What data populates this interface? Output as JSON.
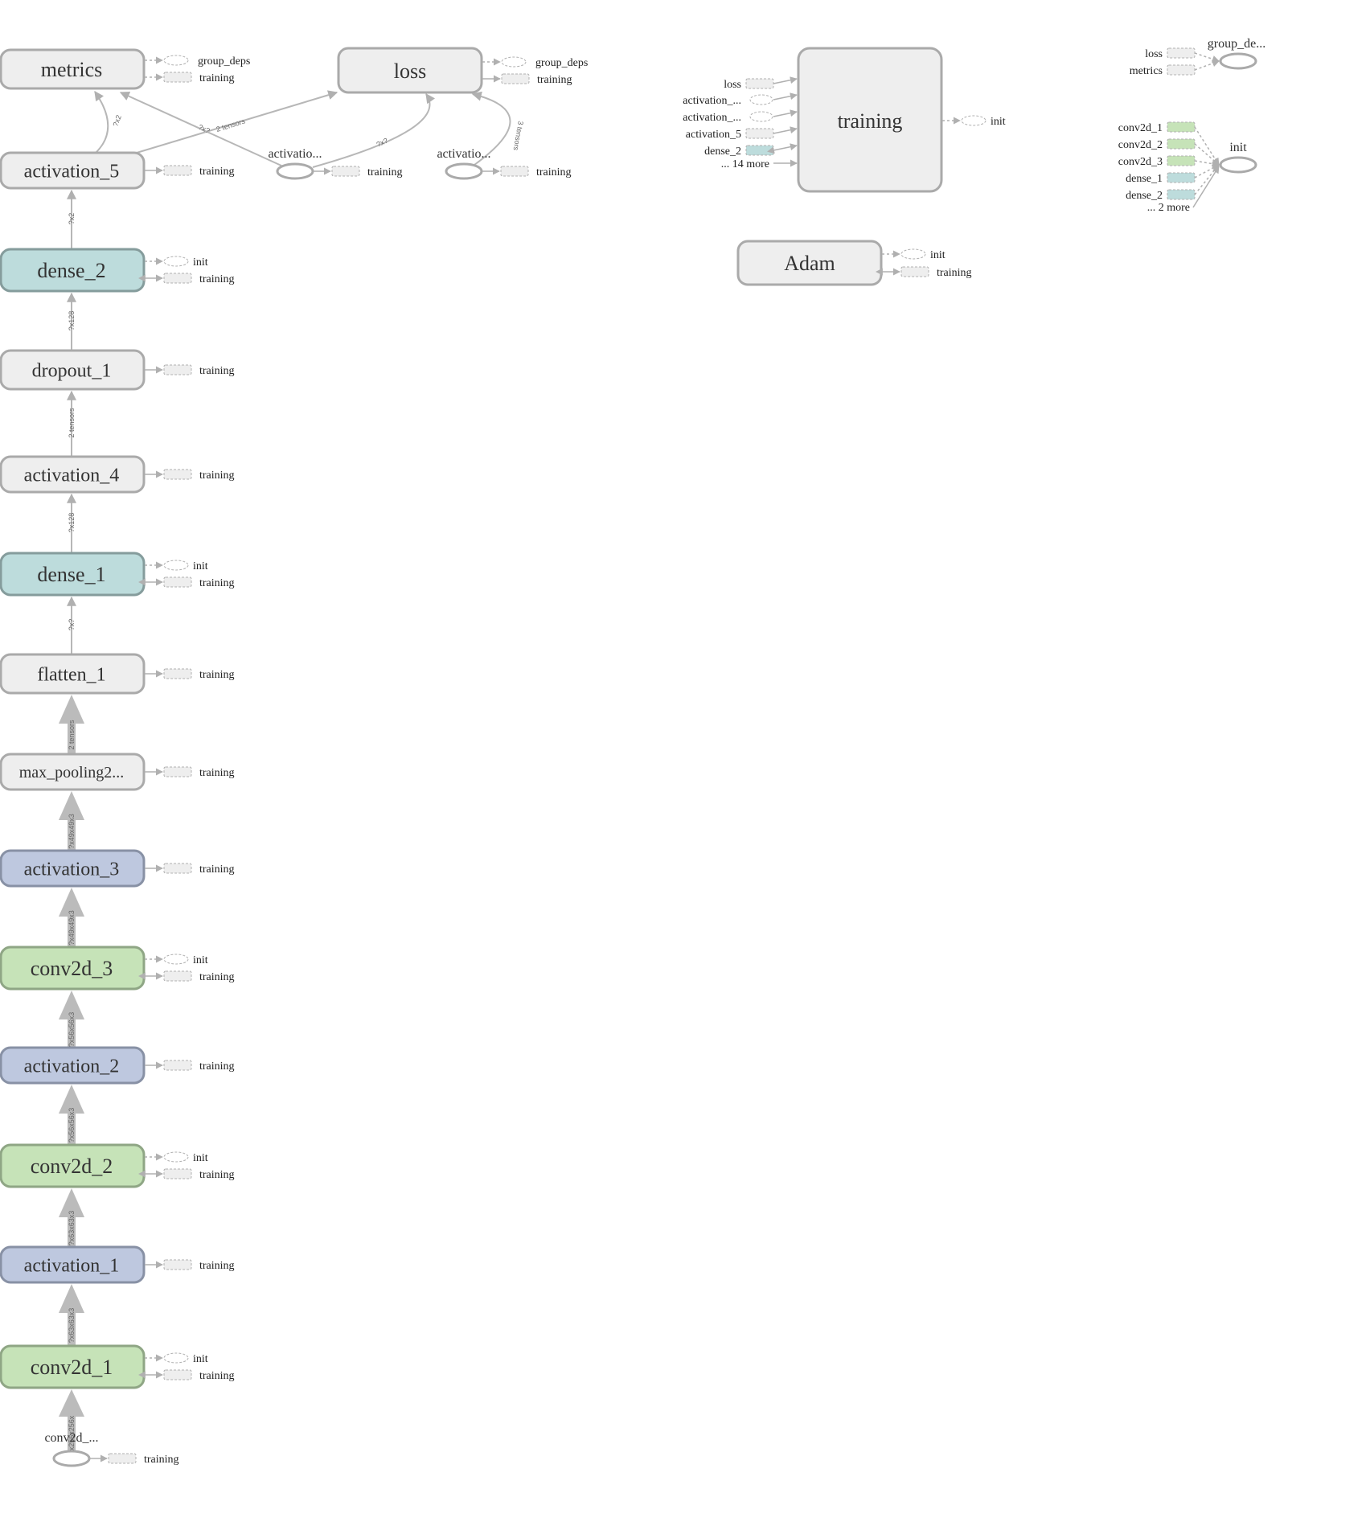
{
  "graph": {
    "colors": {
      "default_fill": "#eeeeee",
      "default_stroke": "#aaaaaa",
      "dense_fill": "#bddcdc",
      "dense_stroke": "#859c9c",
      "conv_fill": "#c6e3b8",
      "conv_stroke": "#8fa685",
      "activation_fill": "#bec8df",
      "activation_stroke": "#8891a5",
      "edge": "#b7b7b7",
      "aux_stroke": "#b0b0b0"
    },
    "main_chain": [
      {
        "id": "metrics",
        "label": "metrics",
        "type": "default",
        "aux": [
          {
            "label": "group_deps",
            "shape": "ellipse",
            "edge": "dotted"
          },
          {
            "label": "training",
            "shape": "rect",
            "edge": "dotted"
          }
        ]
      },
      {
        "id": "activation_5",
        "label": "activation_5",
        "type": "default",
        "aux": [
          {
            "label": "training",
            "shape": "rect",
            "edge": "solid"
          }
        ]
      },
      {
        "id": "dense_2",
        "label": "dense_2",
        "type": "dense",
        "aux": [
          {
            "label": "init",
            "shape": "ellipse",
            "edge": "dotted"
          },
          {
            "label": "training",
            "shape": "rect",
            "edge": "bidir"
          }
        ]
      },
      {
        "id": "dropout_1",
        "label": "dropout_1",
        "type": "default",
        "aux": [
          {
            "label": "training",
            "shape": "rect",
            "edge": "solid"
          }
        ]
      },
      {
        "id": "activation_4",
        "label": "activation_4",
        "type": "default",
        "aux": [
          {
            "label": "training",
            "shape": "rect",
            "edge": "solid"
          }
        ]
      },
      {
        "id": "dense_1",
        "label": "dense_1",
        "type": "dense",
        "aux": [
          {
            "label": "init",
            "shape": "ellipse",
            "edge": "dotted"
          },
          {
            "label": "training",
            "shape": "rect",
            "edge": "bidir"
          }
        ]
      },
      {
        "id": "flatten_1",
        "label": "flatten_1",
        "type": "default",
        "aux": [
          {
            "label": "training",
            "shape": "rect",
            "edge": "solid"
          }
        ]
      },
      {
        "id": "max_pooling2d",
        "label": "max_pooling2...",
        "type": "default",
        "aux": [
          {
            "label": "training",
            "shape": "rect",
            "edge": "solid"
          }
        ]
      },
      {
        "id": "activation_3",
        "label": "activation_3",
        "type": "activation",
        "aux": [
          {
            "label": "training",
            "shape": "rect",
            "edge": "solid"
          }
        ]
      },
      {
        "id": "conv2d_3",
        "label": "conv2d_3",
        "type": "conv",
        "aux": [
          {
            "label": "init",
            "shape": "ellipse",
            "edge": "dotted"
          },
          {
            "label": "training",
            "shape": "rect",
            "edge": "bidir"
          }
        ]
      },
      {
        "id": "activation_2",
        "label": "activation_2",
        "type": "activation",
        "aux": [
          {
            "label": "training",
            "shape": "rect",
            "edge": "solid"
          }
        ]
      },
      {
        "id": "conv2d_2",
        "label": "conv2d_2",
        "type": "conv",
        "aux": [
          {
            "label": "init",
            "shape": "ellipse",
            "edge": "dotted"
          },
          {
            "label": "training",
            "shape": "rect",
            "edge": "bidir"
          }
        ]
      },
      {
        "id": "activation_1",
        "label": "activation_1",
        "type": "activation",
        "aux": [
          {
            "label": "training",
            "shape": "rect",
            "edge": "solid"
          }
        ]
      },
      {
        "id": "conv2d_1",
        "label": "conv2d_1",
        "type": "conv",
        "aux": [
          {
            "label": "init",
            "shape": "ellipse",
            "edge": "dotted"
          },
          {
            "label": "training",
            "shape": "rect",
            "edge": "bidir"
          }
        ]
      }
    ],
    "chain_edges": [
      {
        "label": "",
        "thick": false
      },
      {
        "label": "?x2",
        "thick": false
      },
      {
        "label": "?x128",
        "thick": false
      },
      {
        "label": "2 tensors",
        "thick": false
      },
      {
        "label": "?x128",
        "thick": false
      },
      {
        "label": "?x?",
        "thick": false
      },
      {
        "label": "2 tensors",
        "thick": true
      },
      {
        "label": "?x49x49x3",
        "thick": true
      },
      {
        "label": "?x49x49x3",
        "thick": true
      },
      {
        "label": "?x56x56x3",
        "thick": true
      },
      {
        "label": "?x56x56x3",
        "thick": true
      },
      {
        "label": "?x63x63x3",
        "thick": true
      },
      {
        "label": "?x63x63x3",
        "thick": true
      }
    ],
    "input_node": {
      "label": "conv2d_...",
      "edge_label": "?x256x256x",
      "aux": {
        "label": "training"
      }
    },
    "loss": {
      "label": "loss",
      "aux": [
        {
          "label": "group_deps",
          "shape": "ellipse",
          "edge": "dotted"
        },
        {
          "label": "training",
          "shape": "rect",
          "edge": "solid"
        }
      ]
    },
    "activation_ops": [
      {
        "label": "activatio...",
        "aux": {
          "label": "training"
        },
        "edge_label": "?x?"
      },
      {
        "label": "activatio...",
        "aux": {
          "label": "training"
        },
        "edge_label": "3 tensors"
      }
    ],
    "cross_edges": {
      "act5_to_loss": "2 tensors",
      "act5_to_metrics": "?x2",
      "op1_to_metrics": "?x?"
    },
    "training": {
      "label": "training",
      "inputs": [
        {
          "label": "loss",
          "shape": "rect",
          "type": "default"
        },
        {
          "label": "activation_...",
          "shape": "ellipse",
          "type": "default"
        },
        {
          "label": "activation_...",
          "shape": "ellipse",
          "type": "default"
        },
        {
          "label": "activation_5",
          "shape": "rect",
          "type": "default"
        },
        {
          "label": "dense_2",
          "shape": "rect",
          "type": "dense"
        }
      ],
      "more": "... 14 more",
      "output": {
        "label": "init"
      }
    },
    "adam": {
      "label": "Adam",
      "aux": [
        {
          "label": "init",
          "shape": "ellipse",
          "edge": "dotted"
        },
        {
          "label": "training",
          "shape": "rect",
          "edge": "bidir"
        }
      ]
    },
    "group_deps": {
      "label": "group_de...",
      "inputs": [
        {
          "label": "loss",
          "type": "default"
        },
        {
          "label": "metrics",
          "type": "default"
        }
      ]
    },
    "init": {
      "label": "init",
      "inputs": [
        {
          "label": "conv2d_1",
          "type": "conv"
        },
        {
          "label": "conv2d_2",
          "type": "conv"
        },
        {
          "label": "conv2d_3",
          "type": "conv"
        },
        {
          "label": "dense_1",
          "type": "dense"
        },
        {
          "label": "dense_2",
          "type": "dense"
        }
      ],
      "more": "... 2 more"
    }
  }
}
